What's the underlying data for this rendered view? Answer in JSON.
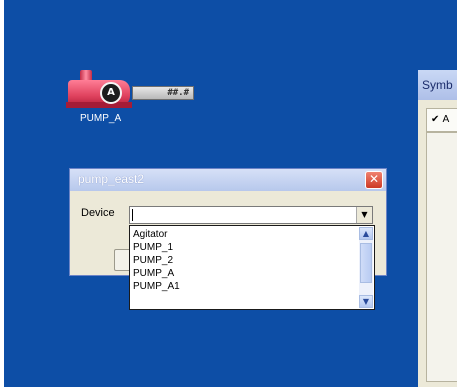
{
  "pump": {
    "label": "PUMP_A",
    "value_display": "##.#",
    "motor_letter": "A",
    "colors": {
      "body": "#e0435f",
      "motor": "#1d1d1d"
    }
  },
  "symbol_window": {
    "title": "Symb",
    "tab_label": "✔ A"
  },
  "dialog": {
    "title": "pump_east2",
    "close_icon": "close-icon",
    "device_label": "Device",
    "device_value": ""
  },
  "dropdown": {
    "items": [
      {
        "label": "Agitator"
      },
      {
        "label": "PUMP_1"
      },
      {
        "label": "PUMP_2"
      },
      {
        "label": "PUMP_A"
      },
      {
        "label": "PUMP_A1"
      }
    ],
    "scroll_up_glyph": "▲",
    "scroll_down_glyph": "▼"
  },
  "colors": {
    "desktop": "#0d4ea6",
    "dialog_bg": "#ece9d8",
    "close_button": "#cd3a25"
  }
}
